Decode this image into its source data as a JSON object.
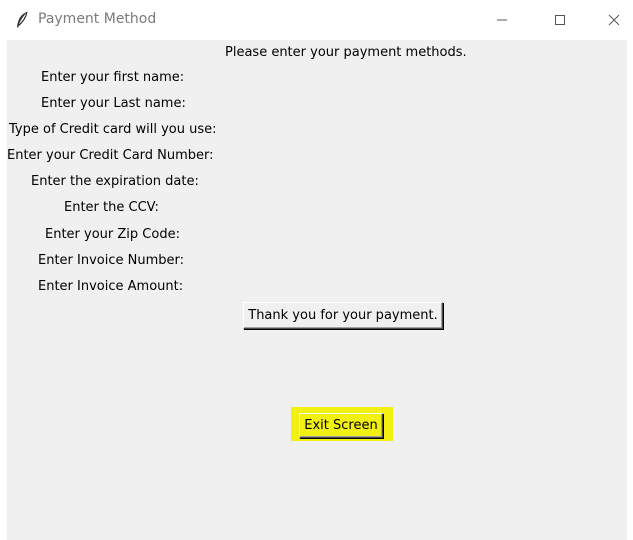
{
  "window": {
    "title": "Payment Method"
  },
  "heading": "Please enter your payment methods.",
  "form": {
    "labels": [
      "Enter your first name:",
      "Enter your Last name:",
      "Type of Credit card will you use:",
      "Enter your Credit Card Number:",
      "Enter the expiration date:",
      "Enter the CCV:",
      "Enter your Zip Code:",
      "Enter Invoice Number:",
      "Enter Invoice Amount:"
    ]
  },
  "buttons": {
    "thanks_label": "Thank you for your payment.",
    "exit_label": "Exit Screen"
  },
  "colors": {
    "window_bg": "#f0f0f0",
    "highlight": "#f2f013"
  },
  "icons": [
    "feather-icon",
    "minimize-icon",
    "maximize-icon",
    "close-icon"
  ]
}
